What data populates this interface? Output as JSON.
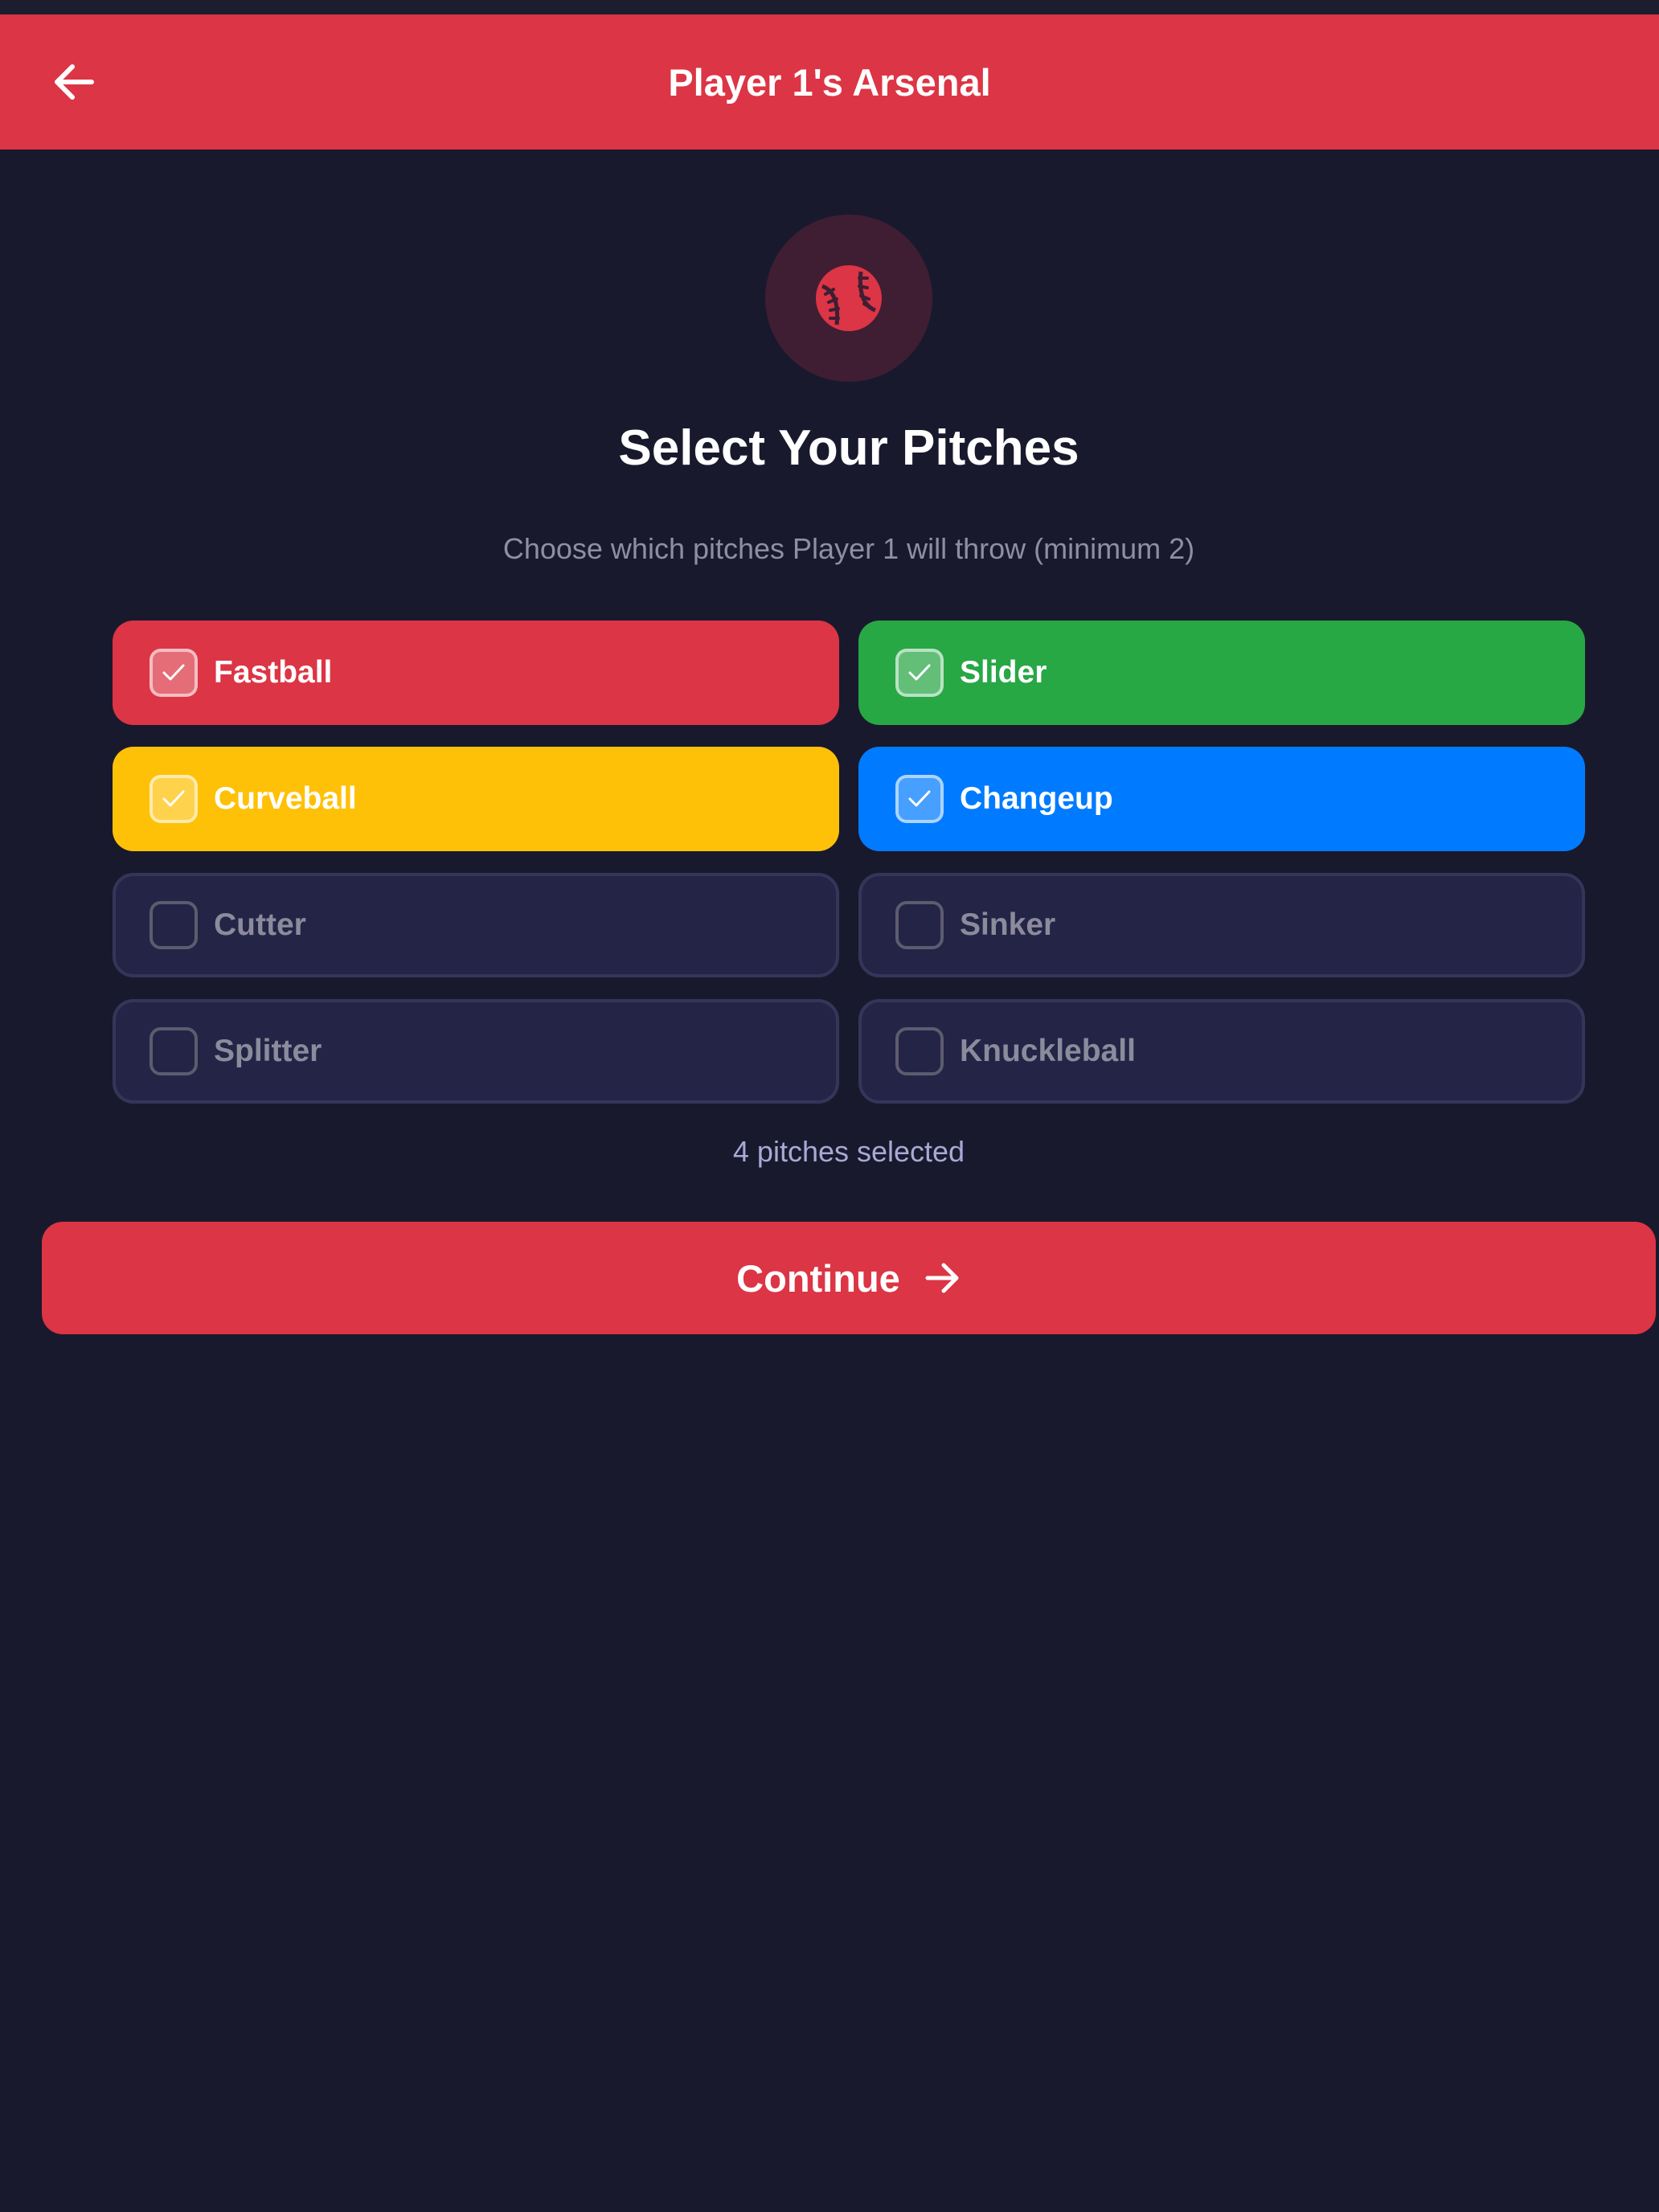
{
  "header": {
    "title": "Player 1's Arsenal",
    "back_icon": "arrow-left-icon",
    "color": "#dc3545"
  },
  "hero": {
    "icon": "baseball-icon",
    "title": "Select Your Pitches",
    "subtitle": "Choose which pitches Player 1 will throw (minimum 2)"
  },
  "pitches": [
    {
      "label": "Fastball",
      "selected": true,
      "color": "#dc3545"
    },
    {
      "label": "Slider",
      "selected": true,
      "color": "#28a745"
    },
    {
      "label": "Curveball",
      "selected": true,
      "color": "#ffc107"
    },
    {
      "label": "Changeup",
      "selected": true,
      "color": "#007bff"
    },
    {
      "label": "Cutter",
      "selected": false
    },
    {
      "label": "Sinker",
      "selected": false
    },
    {
      "label": "Splitter",
      "selected": false
    },
    {
      "label": "Knuckleball",
      "selected": false
    }
  ],
  "selection_count": "4 pitches selected",
  "continue_button": {
    "label": "Continue",
    "icon": "arrow-right-icon"
  }
}
